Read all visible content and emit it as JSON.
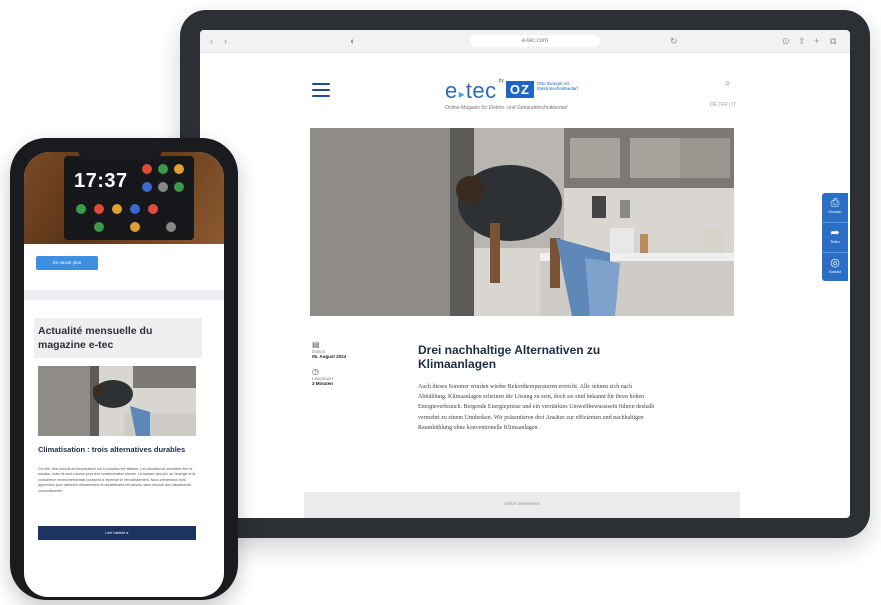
{
  "tablet": {
    "browser": {
      "url": "e-tec.com",
      "nav_back": "‹",
      "nav_forward": "›",
      "reload": "↻",
      "share": "⇧",
      "add_tab": "+",
      "tabs": "⧉"
    },
    "site": {
      "logo_etec_1": "e",
      "logo_arrow": "▸",
      "logo_etec_2": "tec",
      "logo_by": "by",
      "logo_oz": "OZ",
      "logo_oz_text": "Otto Zwiegel AG Elektrotechnikbedarf",
      "tagline": "Online-Magazin für Elektro- und Gebäudetechnikbedarf",
      "lang": "DE | FR | IT"
    },
    "article": {
      "meta_date_label": "Datum",
      "meta_date_value": "05. August 2024",
      "meta_read_label": "Lesedauer",
      "meta_read_value": "3 Minuten",
      "title": "Drei nachhaltige Alternativen zu Klimaanlagen",
      "body": "Auch dieses Sommer wurden wieder Rekordtemperaturen erreicht. Alle sehnen sich nach Abkühlung. Klimaanlagen scheinen die Lösung zu sein, doch sie sind bekannt für ihren hohen Energieverbrauch. Bergende Energiepreise und ein verstärktes Umweltbewusstsein führen deshalb vermehrt zu einem Umdenken. Wir präsentieren drei Ansätze zur effizienten und nachhaltigen Raumkühlung ohne konventionelle Klimaanlagen.",
      "footer_text": "Artikel weiterlesen"
    },
    "share": {
      "print_label": "Drucken",
      "share_label": "Teilen",
      "comment_label": "Kontakt"
    }
  },
  "phone": {
    "hero_time": "17:37",
    "read_more_button": "En savoir plus",
    "card_title": "Actualité mensuelle du magazine e-tec",
    "article_title": "Climatisation : trois alternatives durables",
    "article_body": "Cet été, des records de température ont à nouveau été atteints. Les climatiseurs semblent être la solution, mais ils sont connus pour leur consommation élevée. La hausse des prix de l'énergie et la conscience environnementale poussent à repenser le refroidissement. Nous présentons trois approches pour rafraîchir efficacement et durablement les pièces, sans recourir aux climatiseurs conventionnels.",
    "cta_button": "Lire l'article ▸"
  },
  "colors": {
    "brand_blue": "#2f6ab8",
    "oz_blue": "#1f66c4",
    "navy": "#1b3461",
    "share_blue": "#2b6fc5"
  }
}
